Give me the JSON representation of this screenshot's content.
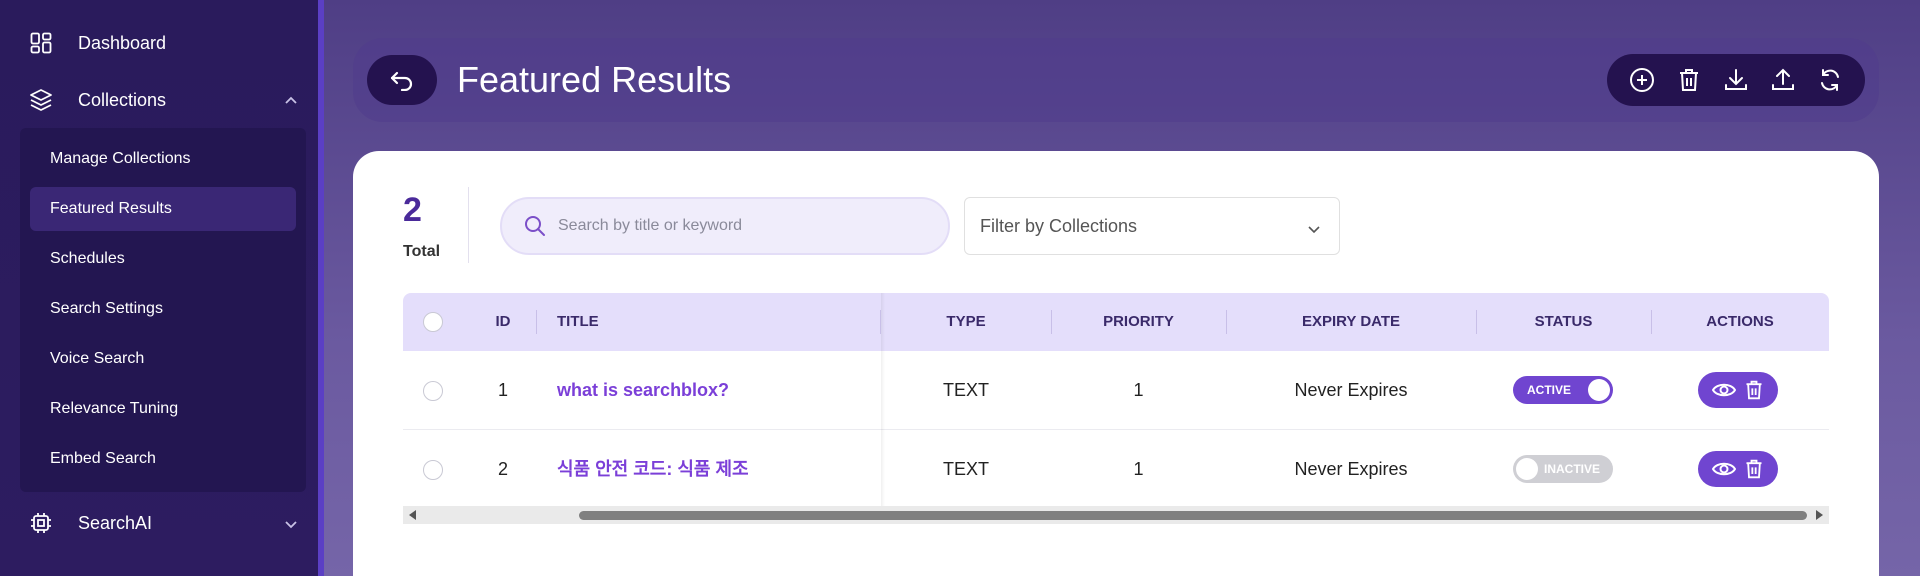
{
  "sidebar": {
    "top_items": [
      {
        "label": "Dashboard",
        "icon": "dashboard-icon"
      },
      {
        "label": "Collections",
        "icon": "layers-icon",
        "expanded": true
      }
    ],
    "collections_submenu": [
      {
        "label": "Manage Collections",
        "active": false
      },
      {
        "label": "Featured Results",
        "active": true
      },
      {
        "label": "Schedules",
        "active": false
      },
      {
        "label": "Search Settings",
        "active": false
      },
      {
        "label": "Voice Search",
        "active": false
      },
      {
        "label": "Relevance Tuning",
        "active": false
      },
      {
        "label": "Embed Search",
        "active": false
      }
    ],
    "bottom_items": [
      {
        "label": "SearchAI",
        "icon": "chip-icon",
        "expanded": false
      }
    ]
  },
  "header": {
    "title": "Featured Results",
    "toolbar_icons": [
      "add-icon",
      "trash-icon",
      "download-icon",
      "upload-icon",
      "refresh-icon"
    ]
  },
  "summary": {
    "total_count": "2",
    "total_label": "Total"
  },
  "search": {
    "placeholder": "Search by title or keyword",
    "value": ""
  },
  "filter": {
    "placeholder": "Filter by Collections"
  },
  "table": {
    "columns": {
      "id": "ID",
      "title": "TITLE",
      "type": "TYPE",
      "priority": "PRIORITY",
      "expiry": "EXPIRY DATE",
      "status": "STATUS",
      "actions": "ACTIONS"
    },
    "rows": [
      {
        "id": "1",
        "title": "what is searchblox?",
        "type": "TEXT",
        "priority": "1",
        "expiry": "Never Expires",
        "status": "ACTIVE",
        "active": true
      },
      {
        "id": "2",
        "title": "식품 안전 코드: 식품 제조",
        "type": "TEXT",
        "priority": "1",
        "expiry": "Never Expires",
        "status": "INACTIVE",
        "active": false
      }
    ]
  },
  "colors": {
    "accent": "#7045d0",
    "sidebar_bg": "#2a1b5c",
    "header_bg": "#24124f",
    "title_link": "#7b3fd8"
  }
}
